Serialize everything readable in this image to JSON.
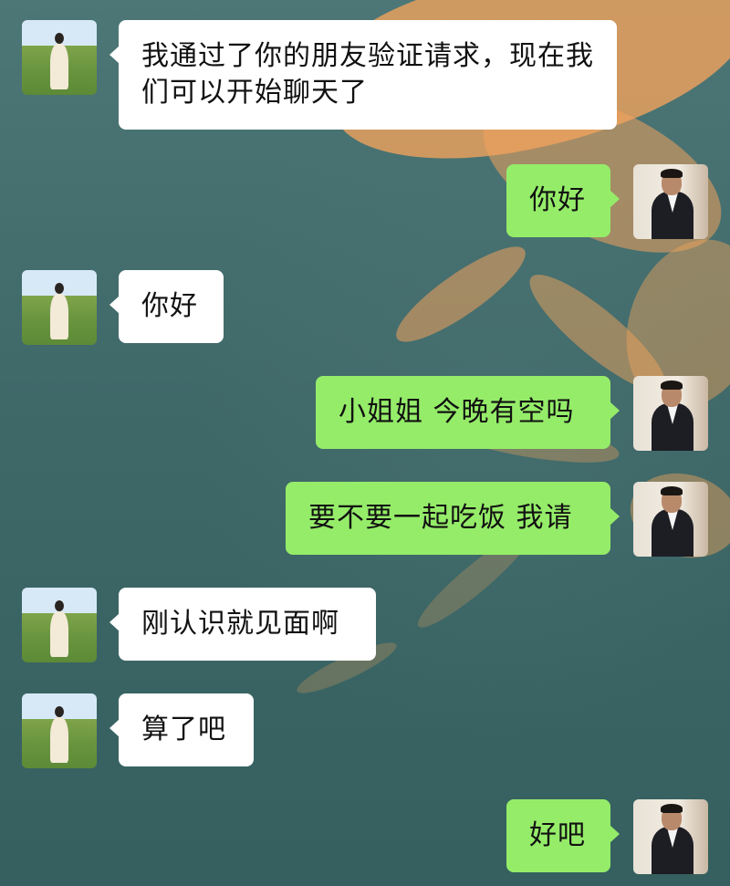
{
  "chat": {
    "messages": [
      {
        "side": "left",
        "avatar": "female-avatar",
        "text": "我通过了你的朋友验证请求，现在我们可以开始聊天了"
      },
      {
        "side": "right",
        "avatar": "male-avatar",
        "text": "你好"
      },
      {
        "side": "left",
        "avatar": "female-avatar",
        "text": "你好"
      },
      {
        "side": "right",
        "avatar": "male-avatar",
        "text": "小姐姐 今晚有空吗"
      },
      {
        "side": "right",
        "avatar": "male-avatar",
        "text": "要不要一起吃饭 我请"
      },
      {
        "side": "left",
        "avatar": "female-avatar",
        "text": "刚认识就见面啊"
      },
      {
        "side": "left",
        "avatar": "female-avatar",
        "text": "算了吧"
      },
      {
        "side": "right",
        "avatar": "male-avatar",
        "text": "好吧"
      }
    ]
  },
  "colors": {
    "incoming_bubble": "#ffffff",
    "outgoing_bubble": "#95ec69",
    "background": "#3f6869",
    "light_pattern": "#f0a35c"
  }
}
